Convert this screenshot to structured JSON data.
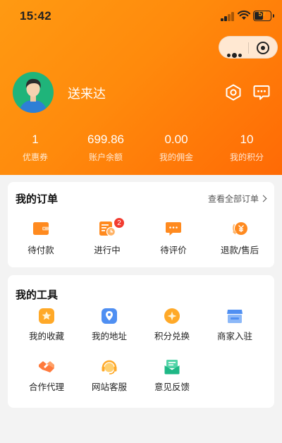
{
  "status_bar": {
    "time": "15:42",
    "battery": "57",
    "battery_level": 0.57
  },
  "profile": {
    "username": "送来达"
  },
  "stats": [
    {
      "value": "1",
      "label": "优惠券"
    },
    {
      "value": "699.86",
      "label": "账户余额"
    },
    {
      "value": "0.00",
      "label": "我的佣金"
    },
    {
      "value": "10",
      "label": "我的积分"
    }
  ],
  "orders": {
    "title": "我的订单",
    "view_all": "查看全部订单",
    "items": [
      {
        "label": "待付款",
        "icon": "wallet-icon"
      },
      {
        "label": "进行中",
        "icon": "clock-list-icon",
        "badge": "2"
      },
      {
        "label": "待评价",
        "icon": "comment-icon"
      },
      {
        "label": "退款/售后",
        "icon": "refund-icon"
      }
    ]
  },
  "tools": {
    "title": "我的工具",
    "items": [
      {
        "label": "我的收藏",
        "icon": "star-icon"
      },
      {
        "label": "我的地址",
        "icon": "location-icon"
      },
      {
        "label": "积分兑换",
        "icon": "points-icon"
      },
      {
        "label": "商家入驻",
        "icon": "store-icon"
      },
      {
        "label": "合作代理",
        "icon": "handshake-icon"
      },
      {
        "label": "网站客服",
        "icon": "headset-icon"
      },
      {
        "label": "意见反馈",
        "icon": "feedback-mail-icon"
      }
    ]
  },
  "colors": {
    "accent": "#ff8a0c",
    "badge": "#f23b2f",
    "page_bg": "#f3f3f3"
  }
}
